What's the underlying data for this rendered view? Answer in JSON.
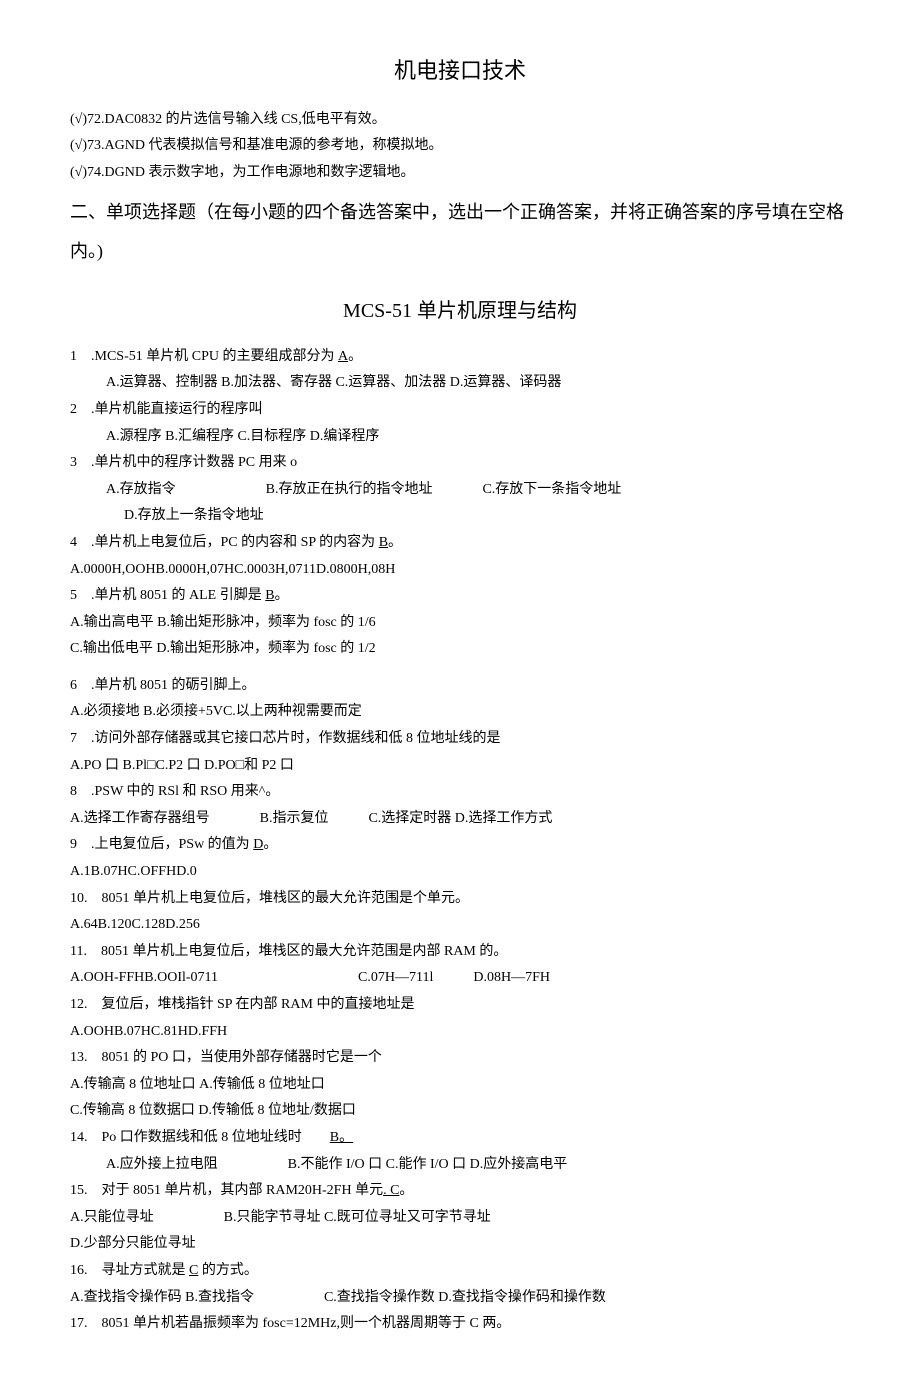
{
  "title": "机电接口技术",
  "tf": {
    "q72": "(√)72.DAC0832 的片选信号输入线 CS,低电平有效。",
    "q73": "(√)73.AGND 代表模拟信号和基准电源的参考地，称模拟地。",
    "q74": "(√)74.DGND 表示数字地，为工作电源地和数字逻辑地。"
  },
  "section2": "二、单项选择题（在每小题的四个备选答案中，选出一个正确答案，并将正确答案的序号填在空格内。)",
  "subtitle": "MCS-51 单片机原理与结构",
  "q1": {
    "stem_a": "1　.MCS-51 单片机 CPU 的主要组成部分为 ",
    "ans": "A",
    "stem_b": "。",
    "opts": "A.运算器、控制器 B.加法器、寄存器 C.运算器、加法器 D.运算器、译码器"
  },
  "q2": {
    "stem": "2　.单片机能直接运行的程序叫",
    "opts": "A.源程序 B.汇编程序 C.目标程序 D.编译程序"
  },
  "q3": {
    "stem": "3　.单片机中的程序计数器 PC 用来 o",
    "a": "A.存放指令",
    "b": "B.存放正在执行的指令地址",
    "c": "C.存放下一条指令地址",
    "d": "D.存放上一条指令地址"
  },
  "q4": {
    "stem_a": "4　.单片机上电复位后，PC 的内容和 SP 的内容为 ",
    "ans": "B",
    "stem_b": "。",
    "opts": "A.0000H,OOHB.0000H,07HC.0003H,0711D.0800H,08H"
  },
  "q5": {
    "stem_a": "5　.单片机 8051 的 ALE 引脚是 ",
    "ans": "B",
    "stem_b": "。",
    "l1": "A.输出高电平 B.输出矩形脉冲，频率为 fosc 的 1/6",
    "l2": "C.输出低电平 D.输出矩形脉冲，频率为 fosc 的 1/2"
  },
  "q6": {
    "stem": "6　.单片机 8051 的砺引脚上。",
    "opts": "A.必须接地 B.必须接+5VC.以上两种视需要而定"
  },
  "q7": {
    "stem": "7　.访问外部存储器或其它接口芯片时，作数据线和低 8 位地址线的是",
    "opts": "A.PO 口 B.Pl□C.P2 口 D.PO□和 P2 口"
  },
  "q8": {
    "stem": "8　.PSW 中的 RSl 和 RSO 用来^。",
    "a": "A.选择工作寄存器组号",
    "b": "B.指示复位",
    "c": "C.选择定时器 D.选择工作方式"
  },
  "q9": {
    "stem_a": "9　.上电复位后，PSw 的值为 ",
    "ans": "D",
    "stem_b": "。",
    "opts": "A.1B.07HC.OFFHD.0"
  },
  "q10": {
    "stem": "10.　8051 单片机上电复位后，堆栈区的最大允许范围是个单元。",
    "opts": "A.64B.120C.128D.256"
  },
  "q11": {
    "stem": "11.　8051 单片机上电复位后，堆栈区的最大允许范围是内部 RAM 的。",
    "a": "A.OOH-FFHB.OOIl-0711",
    "c": "C.07H—711l",
    "d": "D.08H—7FH"
  },
  "q12": {
    "stem": "12.　复位后，堆栈指针 SP 在内部 RAM 中的直接地址是",
    "opts": "A.OOHB.07HC.81HD.FFH"
  },
  "q13": {
    "stem": "13.　8051 的 PO 口，当使用外部存储器时它是一个",
    "l1": "A.传输高 8 位地址口 A.传输低 8 位地址口",
    "l2": "C.传输高 8 位数据口 D.传输低 8 位地址/数据口"
  },
  "q14": {
    "stem_a": "14.　Po 口作数据线和低 8 位地址线时　　",
    "ans": "B。",
    "a": "A.应外接上拉电阻",
    "b": "B.不能作 I/O 口 C.能作 I/O 口 D.应外接高电平"
  },
  "q15": {
    "stem_a": "15.　对于 8051 单片机，其内部 RAM20H-2FH 单元",
    "ans": ". C",
    "stem_b": "。",
    "a": "A.只能位寻址",
    "b": "B.只能字节寻址 C.既可位寻址又可字节寻址",
    "d": "D.少部分只能位寻址"
  },
  "q16": {
    "stem_a": "16.　寻址方式就是 ",
    "ans": "C",
    "stem_b": " 的方式。",
    "a": "A.查找指令操作码 B.查找指令",
    "c": "C.查找指令操作数 D.查找指令操作码和操作数"
  },
  "q17": {
    "stem": "17.　8051 单片机若晶振频率为 fosc=12MHz,则一个机器周期等于 C 两。"
  }
}
